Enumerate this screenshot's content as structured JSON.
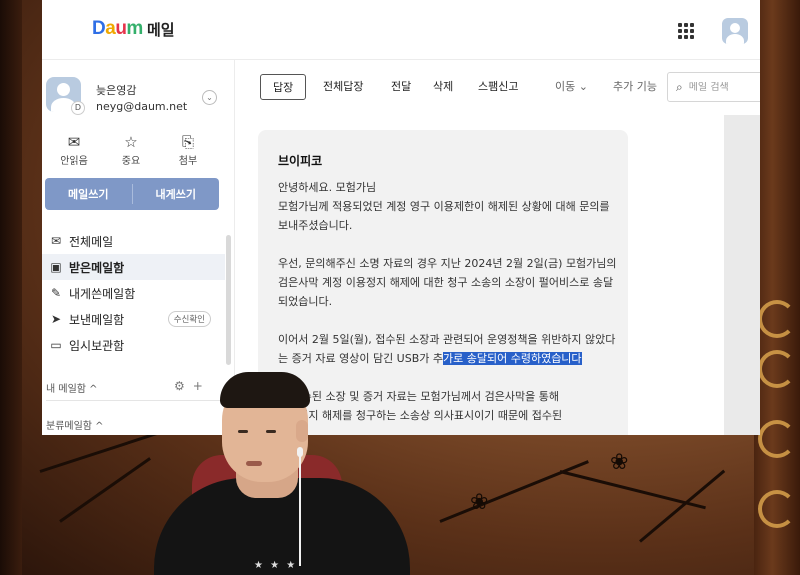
{
  "app": {
    "logo_text": [
      "D",
      "a",
      "u",
      "m"
    ],
    "title": "메일",
    "colors": {
      "accent": "#7f98c7",
      "selection": "#2860c9",
      "logo_blue": "#2f6fe6",
      "logo_yellow": "#f0a800",
      "logo_red": "#e5334b",
      "logo_green": "#34b06b"
    }
  },
  "account": {
    "name": "늦은영감",
    "email": "neyg@daum.net",
    "avatar_badge": "D"
  },
  "quick_links": [
    {
      "label": "안읽음",
      "icon": "envelope-icon"
    },
    {
      "label": "중요",
      "icon": "star-icon"
    },
    {
      "label": "첨부",
      "icon": "paperclip-icon"
    }
  ],
  "compose": {
    "write_label": "메일쓰기",
    "self_label": "내게쓰기"
  },
  "folders": [
    {
      "label": "전체메일",
      "icon": "mail-icon"
    },
    {
      "label": "받은메일함",
      "icon": "inbox-icon",
      "active": true
    },
    {
      "label": "내게쓴메일함",
      "icon": "edit-icon"
    },
    {
      "label": "보낸메일함",
      "icon": "send-icon",
      "badge": "수신확인"
    },
    {
      "label": "임시보관함",
      "icon": "folder-icon"
    }
  ],
  "sections": {
    "my_mailbox": "내 메일함 ^",
    "category": "분류메일함 ^"
  },
  "toolbar": {
    "reply": "답장",
    "reply_all": "전체답장",
    "forward": "전달",
    "delete": "삭제",
    "spam": "스팸신고",
    "move": "이동 ⌄",
    "more": "추가 기능",
    "search_placeholder": "메일 검색"
  },
  "message": {
    "sender": "브이피코",
    "greeting": "안녕하세요. 모험가님",
    "p1": "모험가님께 적용되었던 계정 영구 이용제한이 해제된 상황에 대해 문의를 보내주셨습니다.",
    "p2": "우선, 문의해주신 소명 자료의 경우 지난 2024년 2월 2일(금) 모험가님의 검은사막 계정 이용정지 해제에 대한 청구 소송의 소장이 펄어비스로 송달되었습니다.",
    "p3_before": "이어서 2월 5일(월), 접수된 소장과 관련되어 운영정책을 위반하지 않았다는 증거 자료 영상이 담긴 USB가 추",
    "p3_selected": "가로 송달되어 수령하였습니다",
    "p4_partial": "이 접수된 소장 및 증거 자료는 모험가님께서 검은사막을 통해\n이용정지 해제를 청구하는 소송상 의사표시이기 때문에 접수된"
  },
  "stream": {
    "shirt_text": "★ ★ ★"
  }
}
